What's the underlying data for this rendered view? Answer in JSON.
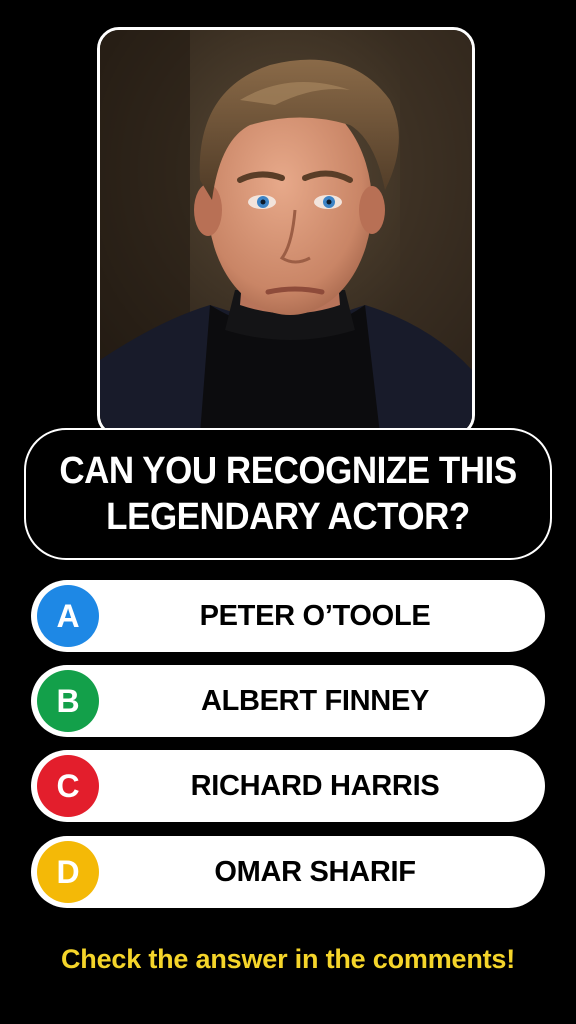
{
  "question": {
    "line1": "CAN YOU RECOGNIZE THIS",
    "line2": "LEGENDARY ACTOR?"
  },
  "answers": [
    {
      "letter": "A",
      "label": "PETER O’TOOLE",
      "color": "#1e88e5"
    },
    {
      "letter": "B",
      "label": "ALBERT FINNEY",
      "color": "#13a04a"
    },
    {
      "letter": "C",
      "label": "RICHARD HARRIS",
      "color": "#e31e2c"
    },
    {
      "letter": "D",
      "label": "OMAR SHARIF",
      "color": "#f4b907"
    }
  ],
  "footer": "Check the answer in the comments!",
  "colors": {
    "background": "#000000",
    "footer_text": "#f5d52a",
    "card": "#ffffff"
  }
}
